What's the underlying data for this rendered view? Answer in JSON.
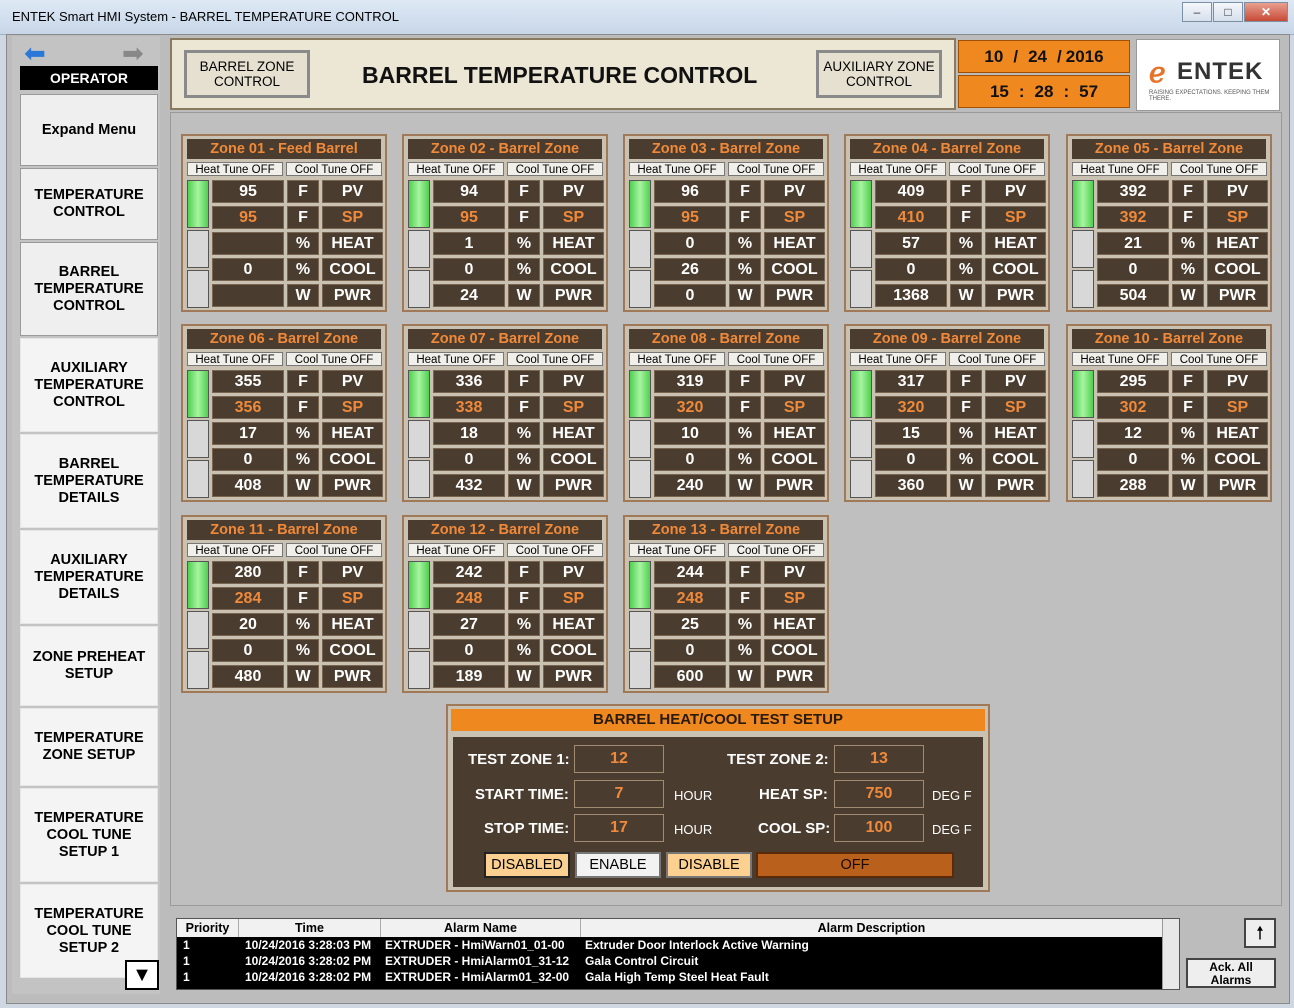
{
  "window": {
    "title": "ENTEK Smart HMI System -  BARREL TEMPERATURE CONTROL"
  },
  "sidebar": {
    "user_label": "OPERATOR",
    "items": [
      "Expand Menu",
      "TEMPERATURE CONTROL",
      "BARREL TEMPERATURE CONTROL",
      "AUXILIARY TEMPERATURE CONTROL",
      "BARREL TEMPERATURE DETAILS",
      "AUXILIARY TEMPERATURE DETAILS",
      "ZONE PREHEAT SETUP",
      "TEMPERATURE ZONE SETUP",
      "TEMPERATURE COOL TUNE SETUP 1",
      "TEMPERATURE COOL TUNE SETUP 2"
    ]
  },
  "header": {
    "left_button": "BARREL ZONE CONTROL",
    "title": "BARREL TEMPERATURE CONTROL",
    "right_button": "AUXILIARY ZONE CONTROL",
    "date": {
      "month": "10",
      "day": "24",
      "year": "2016"
    },
    "time": {
      "hour": "15",
      "minute": "28",
      "second": "57"
    },
    "logo": {
      "name": "ENTEK",
      "tagline": "RAISING EXPECTATIONS. KEEPING THEM THERE."
    }
  },
  "zone_labels": {
    "heat_tune": "Heat Tune OFF",
    "cool_tune": "Cool Tune OFF",
    "units": [
      "F",
      "F",
      "%",
      "%",
      "W"
    ],
    "rows": [
      "PV",
      "SP",
      "HEAT",
      "COOL",
      "PWR"
    ]
  },
  "zones": [
    {
      "name": "Zone 01 - Feed Barrel",
      "pv": "95",
      "sp": "95",
      "heat": "",
      "cool": "0",
      "pwr": ""
    },
    {
      "name": "Zone 02 - Barrel Zone",
      "pv": "94",
      "sp": "95",
      "heat": "1",
      "cool": "0",
      "pwr": "24"
    },
    {
      "name": "Zone 03 - Barrel Zone",
      "pv": "96",
      "sp": "95",
      "heat": "0",
      "cool": "26",
      "pwr": "0"
    },
    {
      "name": "Zone 04 - Barrel Zone",
      "pv": "409",
      "sp": "410",
      "heat": "57",
      "cool": "0",
      "pwr": "1368"
    },
    {
      "name": "Zone 05 - Barrel Zone",
      "pv": "392",
      "sp": "392",
      "heat": "21",
      "cool": "0",
      "pwr": "504"
    },
    {
      "name": "Zone 06 - Barrel Zone",
      "pv": "355",
      "sp": "356",
      "heat": "17",
      "cool": "0",
      "pwr": "408"
    },
    {
      "name": "Zone 07 - Barrel Zone",
      "pv": "336",
      "sp": "338",
      "heat": "18",
      "cool": "0",
      "pwr": "432"
    },
    {
      "name": "Zone 08 - Barrel Zone",
      "pv": "319",
      "sp": "320",
      "heat": "10",
      "cool": "0",
      "pwr": "240"
    },
    {
      "name": "Zone 09 - Barrel Zone",
      "pv": "317",
      "sp": "320",
      "heat": "15",
      "cool": "0",
      "pwr": "360"
    },
    {
      "name": "Zone 10 - Barrel Zone",
      "pv": "295",
      "sp": "302",
      "heat": "12",
      "cool": "0",
      "pwr": "288"
    },
    {
      "name": "Zone 11 - Barrel Zone",
      "pv": "280",
      "sp": "284",
      "heat": "20",
      "cool": "0",
      "pwr": "480"
    },
    {
      "name": "Zone 12 - Barrel Zone",
      "pv": "242",
      "sp": "248",
      "heat": "27",
      "cool": "0",
      "pwr": "189"
    },
    {
      "name": "Zone 13 - Barrel Zone",
      "pv": "244",
      "sp": "248",
      "heat": "25",
      "cool": "0",
      "pwr": "600"
    }
  ],
  "test_setup": {
    "title": "BARREL HEAT/COOL TEST SETUP",
    "test_zone_1_label": "TEST ZONE 1:",
    "test_zone_1": "12",
    "test_zone_2_label": "TEST ZONE 2:",
    "test_zone_2": "13",
    "start_time_label": "START TIME:",
    "start_time": "7",
    "start_unit": "HOUR",
    "heat_sp_label": "HEAT SP:",
    "heat_sp": "750",
    "heat_unit": "DEG F",
    "stop_time_label": "STOP TIME:",
    "stop_time": "17",
    "stop_unit": "HOUR",
    "cool_sp_label": "COOL SP:",
    "cool_sp": "100",
    "cool_unit": "DEG F",
    "status": "DISABLED",
    "enable_label": "ENABLE",
    "disable_label": "DISABLE",
    "state": "OFF"
  },
  "alarms": {
    "columns": [
      "Priority",
      "Time",
      "Alarm Name",
      "Alarm Description"
    ],
    "rows": [
      {
        "priority": "1",
        "time": "10/24/2016 3:28:03 PM",
        "name": "EXTRUDER - HmiWarn01_01-00",
        "desc": "Extruder Door Interlock Active Warning"
      },
      {
        "priority": "1",
        "time": "10/24/2016 3:28:02 PM",
        "name": "EXTRUDER - HmiAlarm01_31-12",
        "desc": "Gala Control Circuit"
      },
      {
        "priority": "1",
        "time": "10/24/2016 3:28:02 PM",
        "name": "EXTRUDER - HmiAlarm01_32-00",
        "desc": "Gala High Temp Steel Heat Fault"
      }
    ],
    "ack_label": "Ack. All Alarms"
  }
}
